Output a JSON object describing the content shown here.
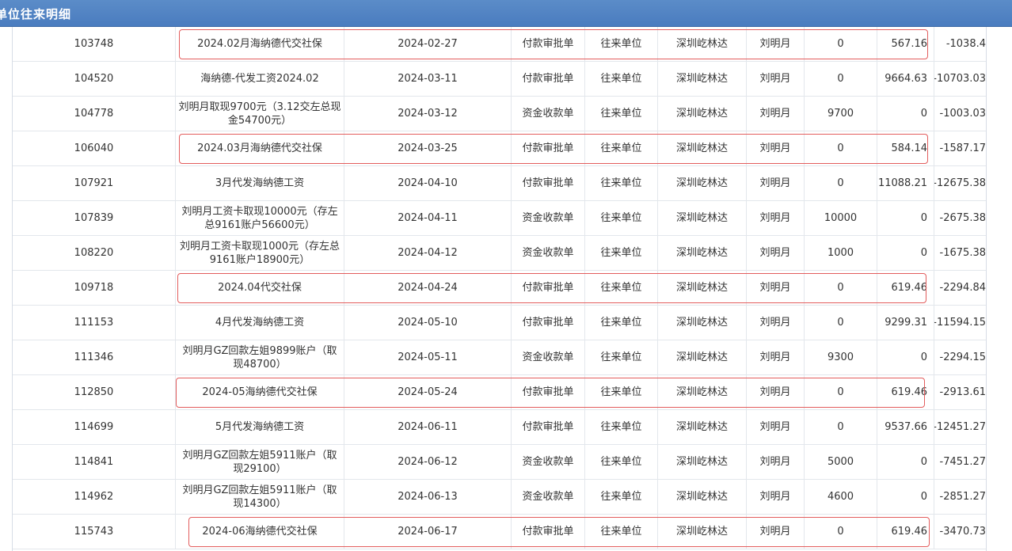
{
  "header": {
    "title": "单位往来明细"
  },
  "rows": [
    {
      "id": "103748",
      "desc": "2024.02月海纳德代交社保",
      "date": "2024-02-27",
      "type": "付款审批单",
      "category": "往来单位",
      "company": "深圳屹林达",
      "person": "刘明月",
      "income": "0",
      "expense": "567.16",
      "balance": "-1038.4",
      "highlighted": true
    },
    {
      "id": "104520",
      "desc": "海纳德-代发工资2024.02",
      "date": "2024-03-11",
      "type": "付款审批单",
      "category": "往来单位",
      "company": "深圳屹林达",
      "person": "刘明月",
      "income": "0",
      "expense": "9664.63",
      "balance": "-10703.03",
      "highlighted": false
    },
    {
      "id": "104778",
      "desc": "刘明月取现9700元（3.12交左总现金54700元）",
      "date": "2024-03-12",
      "type": "资金收款单",
      "category": "往来单位",
      "company": "深圳屹林达",
      "person": "刘明月",
      "income": "9700",
      "expense": "0",
      "balance": "-1003.03",
      "highlighted": false
    },
    {
      "id": "106040",
      "desc": "2024.03月海纳德代交社保",
      "date": "2024-03-25",
      "type": "付款审批单",
      "category": "往来单位",
      "company": "深圳屹林达",
      "person": "刘明月",
      "income": "0",
      "expense": "584.14",
      "balance": "-1587.17",
      "highlighted": true
    },
    {
      "id": "107921",
      "desc": "3月代发海纳德工资",
      "date": "2024-04-10",
      "type": "付款审批单",
      "category": "往来单位",
      "company": "深圳屹林达",
      "person": "刘明月",
      "income": "0",
      "expense": "11088.21",
      "balance": "-12675.38",
      "highlighted": false
    },
    {
      "id": "107839",
      "desc": "刘明月工资卡取现10000元（存左总9161账户56600元）",
      "date": "2024-04-11",
      "type": "资金收款单",
      "category": "往来单位",
      "company": "深圳屹林达",
      "person": "刘明月",
      "income": "10000",
      "expense": "0",
      "balance": "-2675.38",
      "highlighted": false
    },
    {
      "id": "108220",
      "desc": "刘明月工资卡取现1000元（存左总9161账户18900元）",
      "date": "2024-04-12",
      "type": "资金收款单",
      "category": "往来单位",
      "company": "深圳屹林达",
      "person": "刘明月",
      "income": "1000",
      "expense": "0",
      "balance": "-1675.38",
      "highlighted": false
    },
    {
      "id": "109718",
      "desc": "2024.04代交社保",
      "date": "2024-04-24",
      "type": "付款审批单",
      "category": "往来单位",
      "company": "深圳屹林达",
      "person": "刘明月",
      "income": "0",
      "expense": "619.46",
      "balance": "-2294.84",
      "highlighted": true
    },
    {
      "id": "111153",
      "desc": "4月代发海纳德工资",
      "date": "2024-05-10",
      "type": "付款审批单",
      "category": "往来单位",
      "company": "深圳屹林达",
      "person": "刘明月",
      "income": "0",
      "expense": "9299.31",
      "balance": "-11594.15",
      "highlighted": false
    },
    {
      "id": "111346",
      "desc": "刘明月GZ回款左姐9899账户（取现48700）",
      "date": "2024-05-11",
      "type": "资金收款单",
      "category": "往来单位",
      "company": "深圳屹林达",
      "person": "刘明月",
      "income": "9300",
      "expense": "0",
      "balance": "-2294.15",
      "highlighted": false
    },
    {
      "id": "112850",
      "desc": "2024-05海纳德代交社保",
      "date": "2024-05-24",
      "type": "付款审批单",
      "category": "往来单位",
      "company": "深圳屹林达",
      "person": "刘明月",
      "income": "0",
      "expense": "619.46",
      "balance": "-2913.61",
      "highlighted": true
    },
    {
      "id": "114699",
      "desc": "5月代发海纳德工资",
      "date": "2024-06-11",
      "type": "付款审批单",
      "category": "往来单位",
      "company": "深圳屹林达",
      "person": "刘明月",
      "income": "0",
      "expense": "9537.66",
      "balance": "-12451.27",
      "highlighted": false
    },
    {
      "id": "114841",
      "desc": "刘明月GZ回款左姐5911账户（取现29100）",
      "date": "2024-06-12",
      "type": "资金收款单",
      "category": "往来单位",
      "company": "深圳屹林达",
      "person": "刘明月",
      "income": "5000",
      "expense": "0",
      "balance": "-7451.27",
      "highlighted": false
    },
    {
      "id": "114962",
      "desc": "刘明月GZ回款左姐5911账户（取现14300）",
      "date": "2024-06-13",
      "type": "资金收款单",
      "category": "往来单位",
      "company": "深圳屹林达",
      "person": "刘明月",
      "income": "4600",
      "expense": "0",
      "balance": "-2851.27",
      "highlighted": false
    },
    {
      "id": "115743",
      "desc": "2024-06海纳德代交社保",
      "date": "2024-06-17",
      "type": "付款审批单",
      "category": "往来单位",
      "company": "深圳屹林达",
      "person": "刘明月",
      "income": "0",
      "expense": "619.46",
      "balance": "-3470.73",
      "highlighted": true
    }
  ],
  "colors": {
    "header": "#4a7cbf",
    "highlight": "#e35d5d",
    "gridline": "#e3e7ec"
  }
}
